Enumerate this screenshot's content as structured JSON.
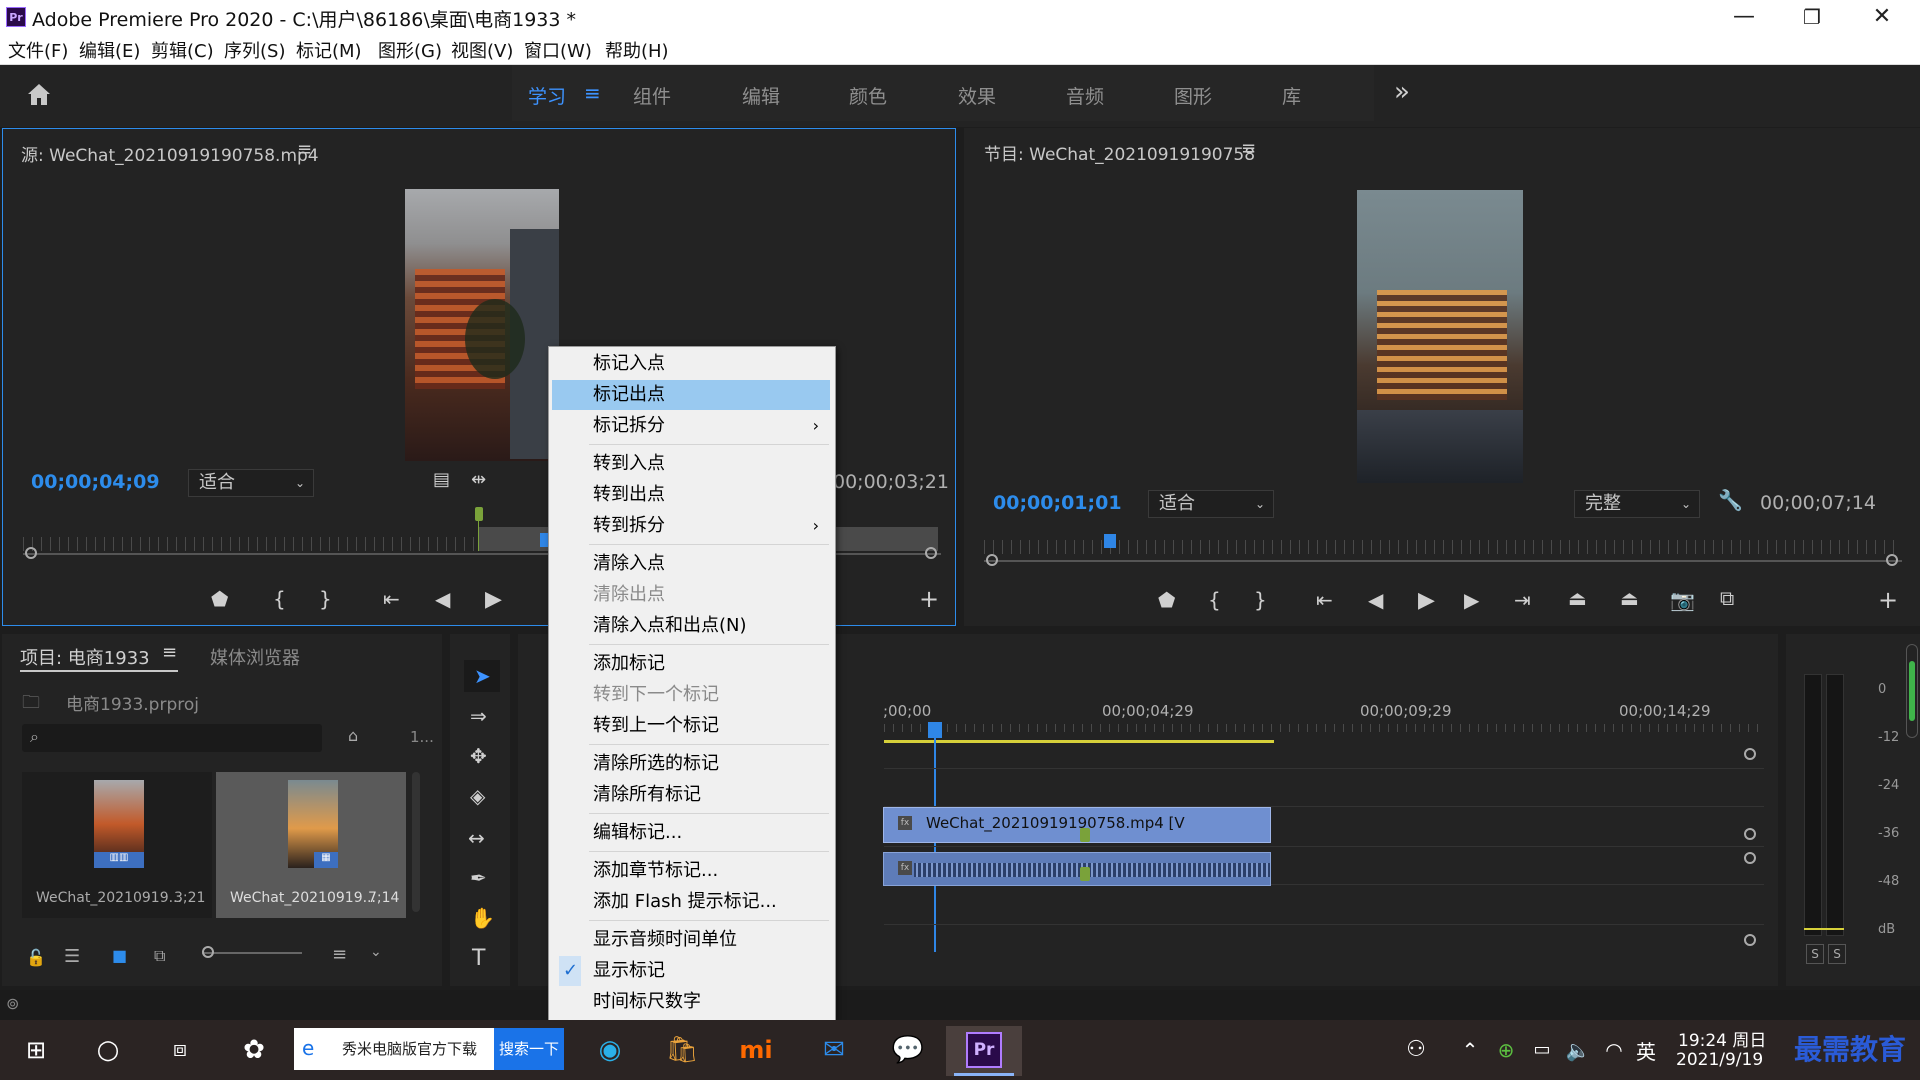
{
  "window": {
    "logo": "Pr",
    "title": "Adobe Premiere Pro 2020 - C:\\用户\\86186\\桌面\\电商1933 *",
    "minimize": "—",
    "maximize": "❐",
    "close": "✕"
  },
  "menu": [
    "文件(F)",
    "编辑(E)",
    "剪辑(C)",
    "序列(S)",
    "标记(M)",
    "图形(G)",
    "视图(V)",
    "窗口(W)",
    "帮助(H)"
  ],
  "workspaces": {
    "tabs": [
      "学习",
      "组件",
      "编辑",
      "颜色",
      "效果",
      "音频",
      "图形",
      "库"
    ],
    "active": "学习",
    "more": "»"
  },
  "source_monitor": {
    "title": "源: WeChat_20210919190758.mp4",
    "timecode": "00;00;04;09",
    "fit": "适合",
    "duration": "00;00;03;21"
  },
  "program_monitor": {
    "title": "节目: WeChat_20210919190758",
    "timecode": "00;00;01;01",
    "fit": "适合",
    "quality": "完整",
    "duration": "00;00;07;14"
  },
  "project_panel": {
    "tab": "项目: 电商1933",
    "media_browser": "媒体浏览器",
    "file": "电商1933.prproj",
    "page_indicator": "1...",
    "items": [
      {
        "name": "WeChat_20210919...",
        "duration": "3;21"
      },
      {
        "name": "WeChat_20210919...",
        "duration": "7;14"
      }
    ]
  },
  "timeline": {
    "ticks": [
      ";00;00",
      "00;00;04;29",
      "00;00;09;29",
      "00;00;14;29"
    ],
    "video_clip": "WeChat_20210919190758.mp4 [V",
    "fx": "fx"
  },
  "audio_meter": {
    "scale": [
      "0",
      "-12",
      "-24",
      "-36",
      "-48",
      "dB"
    ],
    "solo": [
      "S",
      "S"
    ]
  },
  "context_menu": {
    "items": [
      {
        "label": "标记入点",
        "state": "normal"
      },
      {
        "label": "标记出点",
        "state": "highlighted"
      },
      {
        "label": "标记拆分",
        "state": "submenu"
      },
      {
        "label": "转到入点",
        "state": "normal"
      },
      {
        "label": "转到出点",
        "state": "normal"
      },
      {
        "label": "转到拆分",
        "state": "submenu"
      },
      {
        "label": "清除入点",
        "state": "normal"
      },
      {
        "label": "清除出点",
        "state": "disabled"
      },
      {
        "label": "清除入点和出点(N)",
        "state": "normal"
      },
      {
        "label": "添加标记",
        "state": "normal"
      },
      {
        "label": "转到下一个标记",
        "state": "disabled"
      },
      {
        "label": "转到上一个标记",
        "state": "normal"
      },
      {
        "label": "清除所选的标记",
        "state": "normal"
      },
      {
        "label": "清除所有标记",
        "state": "normal"
      },
      {
        "label": "编辑标记...",
        "state": "normal"
      },
      {
        "label": "添加章节标记...",
        "state": "normal"
      },
      {
        "label": "添加 Flash 提示标记...",
        "state": "normal"
      },
      {
        "label": "显示音频时间单位",
        "state": "normal"
      },
      {
        "label": "显示标记",
        "state": "checked"
      },
      {
        "label": "时间标尺数字",
        "state": "normal"
      }
    ]
  },
  "taskbar": {
    "search_text": "秀米电脑版官方下载",
    "search_button": "搜索一下",
    "ime": "英",
    "time": "19:24 周日",
    "date": "2021/9/19",
    "watermark": "最需教育",
    "premiere_label": "Pr"
  },
  "colors": {
    "accent": "#2d8ceb",
    "highlight": "#99c9f0",
    "clip_video": "#6f8fd0",
    "clip_audio": "#5e7cb8",
    "playhead": "#2f86e6",
    "workarea": "#d6d03a"
  }
}
